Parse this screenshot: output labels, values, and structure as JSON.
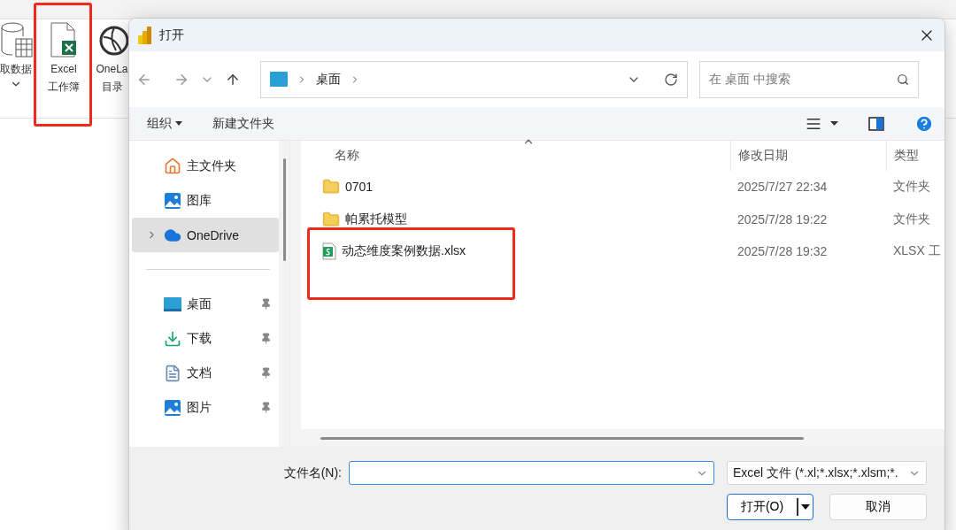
{
  "background_app": {
    "ribbon_buttons": [
      {
        "kind": "database",
        "lines": [
          "取数据"
        ],
        "has_menu": true
      },
      {
        "kind": "excel",
        "lines": [
          "Excel",
          "工作簿"
        ],
        "has_menu": false
      },
      {
        "kind": "onelake",
        "lines": [
          "OneLa",
          "目录"
        ],
        "has_menu": false
      }
    ]
  },
  "dialog": {
    "title": "打开",
    "address": {
      "segments": [
        "桌面"
      ]
    },
    "search": {
      "placeholder": "在 桌面 中搜索"
    },
    "toolbar": {
      "organize": "组织",
      "new_folder": "新建文件夹"
    },
    "sidebar": {
      "items": [
        {
          "kind": "home",
          "label": "主文件夹",
          "pinned": false,
          "selected": false,
          "expandable": false
        },
        {
          "kind": "gallery",
          "label": "图库",
          "pinned": false,
          "selected": false,
          "expandable": false
        },
        {
          "kind": "cloud",
          "label": "OneDrive",
          "pinned": false,
          "selected": true,
          "expandable": true
        },
        {
          "kind": "divider"
        },
        {
          "kind": "desktop",
          "label": "桌面",
          "pinned": true,
          "selected": false,
          "expandable": false
        },
        {
          "kind": "download",
          "label": "下载",
          "pinned": true,
          "selected": false,
          "expandable": false
        },
        {
          "kind": "document",
          "label": "文档",
          "pinned": true,
          "selected": false,
          "expandable": false
        },
        {
          "kind": "picture",
          "label": "图片",
          "pinned": true,
          "selected": false,
          "expandable": false
        }
      ]
    },
    "files": {
      "columns": [
        "名称",
        "修改日期",
        "类型"
      ],
      "rows": [
        {
          "kind": "folder",
          "name": "0701",
          "date": "2025/7/27 22:34",
          "type": "文件夹"
        },
        {
          "kind": "folder",
          "name": "帕累托模型",
          "date": "2025/7/28 19:22",
          "type": "文件夹"
        },
        {
          "kind": "xlsx",
          "name": "动态维度案例数据.xlsx",
          "date": "2025/7/28 19:32",
          "type": "XLSX 工"
        }
      ]
    },
    "filename": {
      "label": "文件名(N):"
    },
    "filter": {
      "value": "Excel 文件 (*.xl;*.xlsx;*.xlsm;*."
    },
    "buttons": {
      "open": "打开(O)",
      "cancel": "取消"
    }
  }
}
